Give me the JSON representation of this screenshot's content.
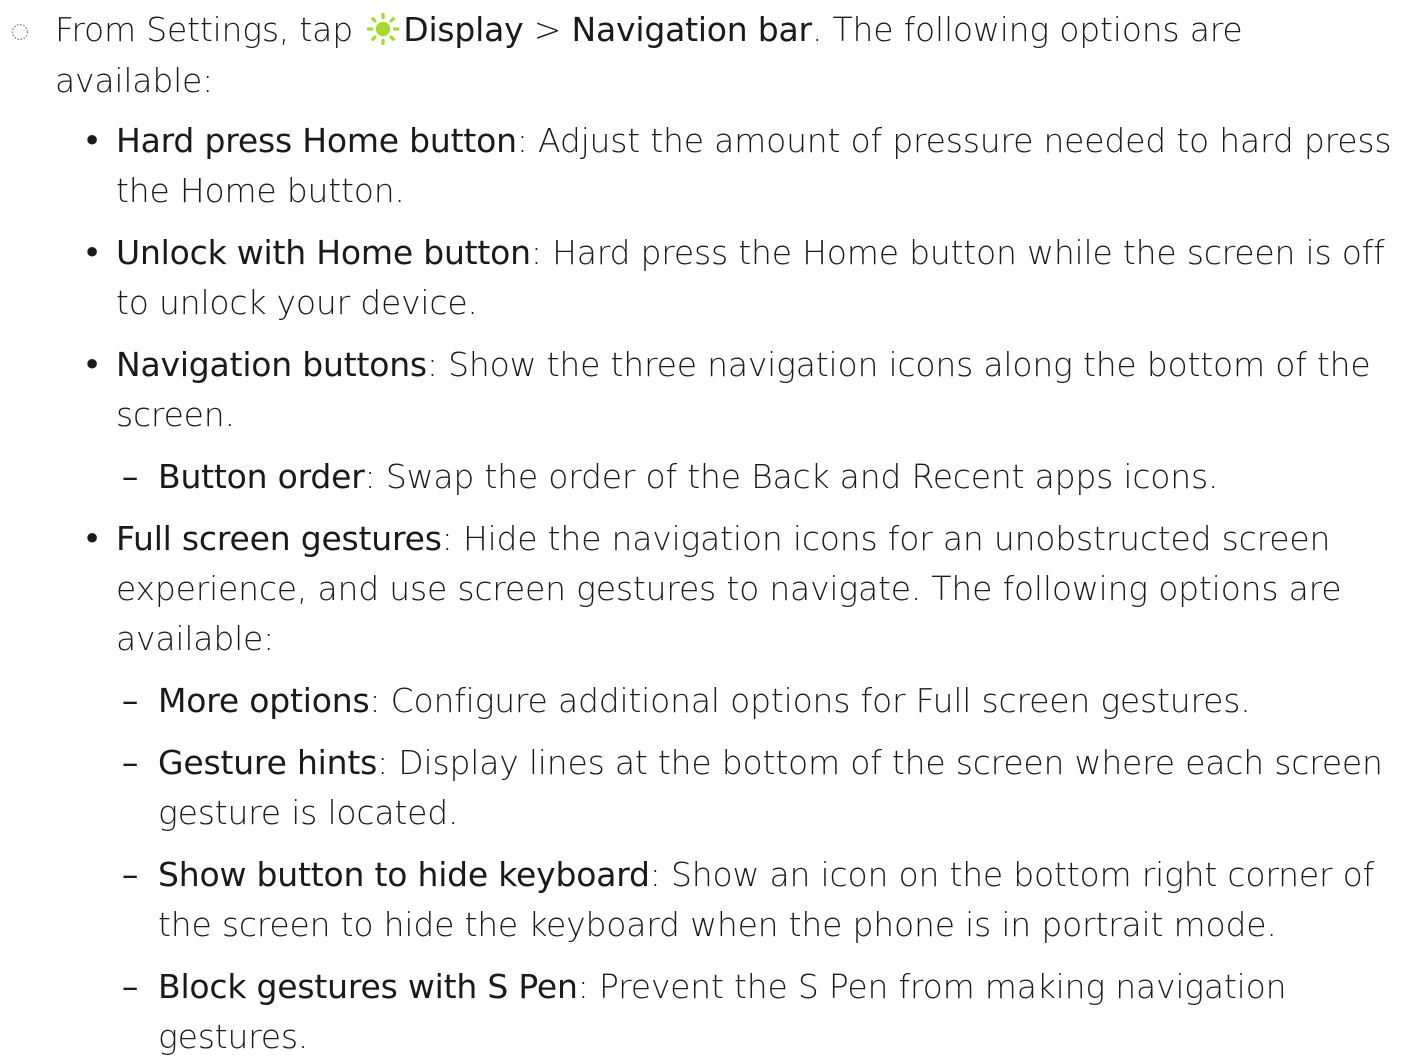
{
  "step": {
    "icon": "step-circle-icon",
    "prefix": "From Settings, tap ",
    "display_icon": "display-sun-icon",
    "display_label": "Display",
    "separator": " > ",
    "nav_label": "Navigation bar",
    "suffix": ". The following options are available:"
  },
  "colors": {
    "display_icon": "#a6d928",
    "text": "#1a1a1a"
  },
  "items": [
    {
      "term": "Hard press Home button",
      "desc": ": Adjust the amount of pressure needed to hard press the Home button."
    },
    {
      "term": "Unlock with Home button",
      "desc": ": Hard press the Home button while the screen is off to unlock your device."
    },
    {
      "term": "Navigation buttons",
      "desc": ": Show the three navigation icons along the bottom of the screen."
    },
    {
      "term": "Button order",
      "desc": ": Swap the order of the Back and Recent apps icons."
    },
    {
      "term": "Full screen gestures",
      "desc": ": Hide the navigation icons for an unobstructed screen experience, and use screen gestures to navigate. The following options are available:"
    },
    {
      "term": "More options",
      "desc": ": Configure additional options for Full screen gestures."
    },
    {
      "term": "Gesture hints",
      "desc": ": Display lines at the bottom of the screen where each screen gesture is located."
    },
    {
      "term": "Show button to hide keyboard",
      "desc": ": Show an icon on the bottom right corner of the screen to hide the keyboard when the phone is in portrait mode."
    },
    {
      "term": "Block gestures with S Pen",
      "desc": ": Prevent the S Pen from making navigation gestures."
    }
  ],
  "markers": {
    "bullet": "•",
    "dash": "–"
  }
}
